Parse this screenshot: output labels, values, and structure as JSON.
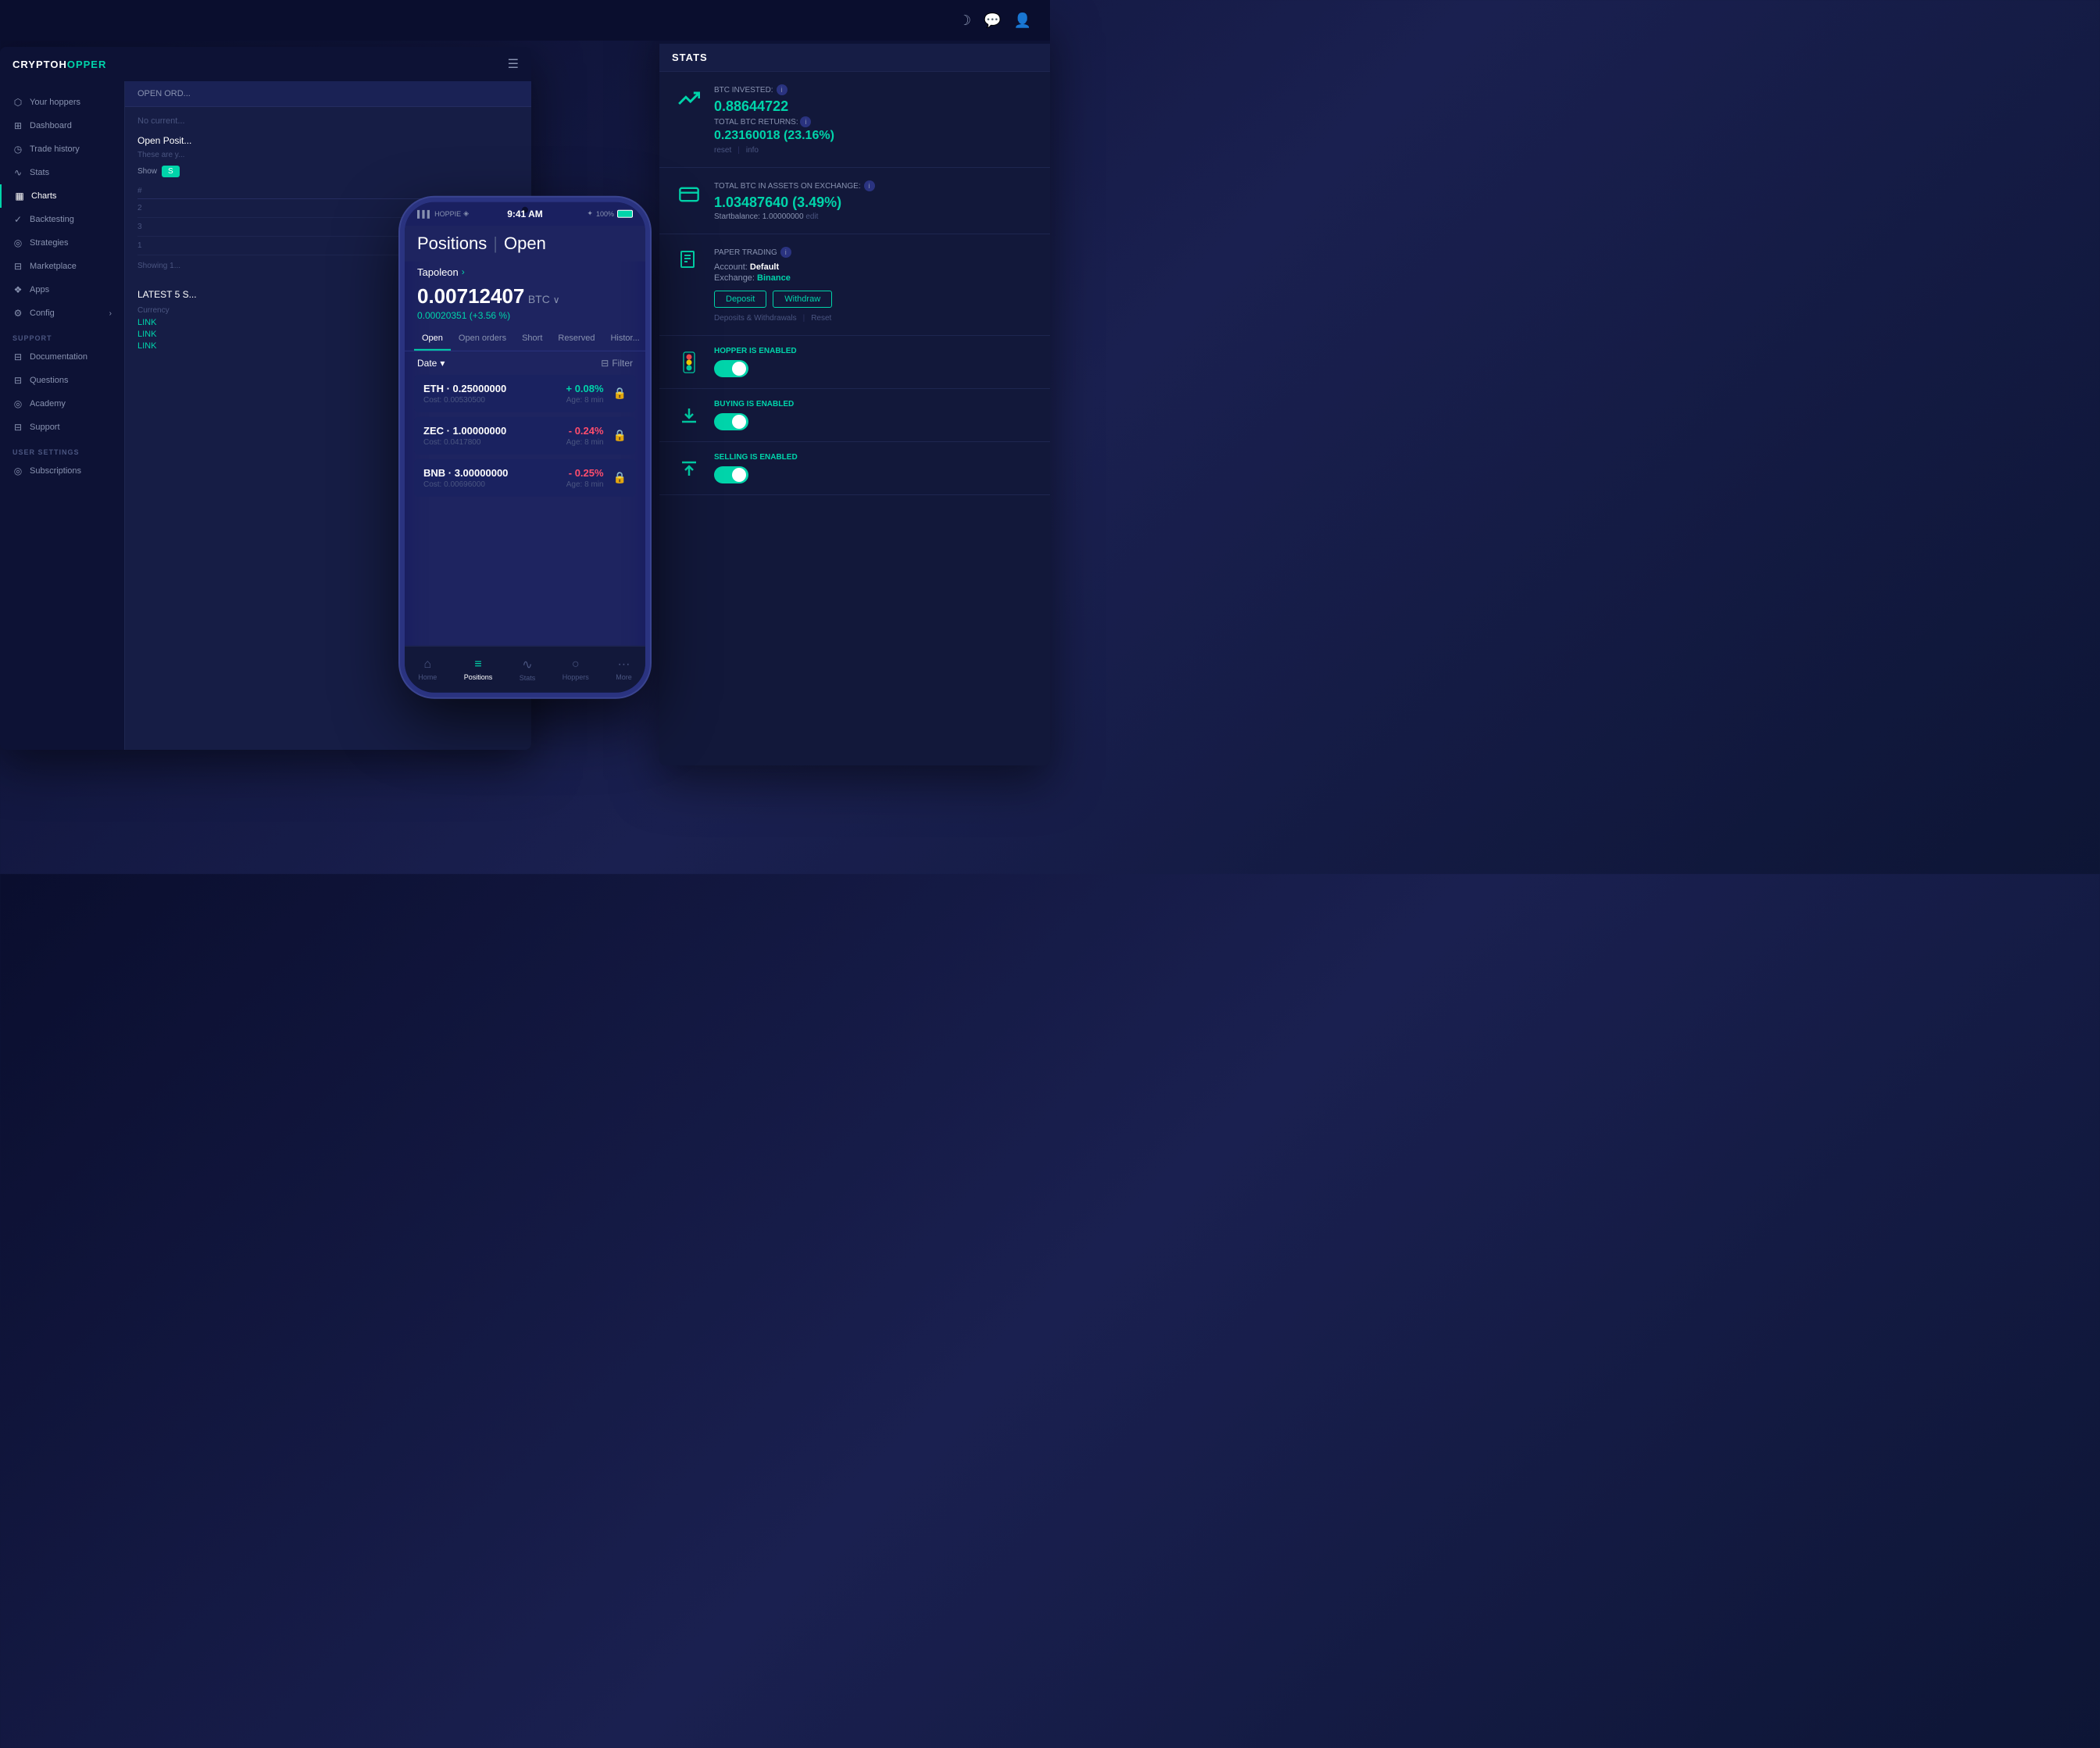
{
  "global": {
    "topbar_icons": [
      "moon",
      "chat",
      "user"
    ]
  },
  "desktop": {
    "logo": "CRYPTOH",
    "logo_accent": "OPPER",
    "sidebar": {
      "items": [
        {
          "id": "your-hoppers",
          "icon": "⬡",
          "label": "Your hoppers"
        },
        {
          "id": "dashboard",
          "icon": "⊞",
          "label": "Dashboard"
        },
        {
          "id": "trade-history",
          "icon": "◷",
          "label": "Trade history"
        },
        {
          "id": "stats",
          "icon": "∿",
          "label": "Stats"
        },
        {
          "id": "charts",
          "icon": "▦",
          "label": "Charts",
          "active": true
        },
        {
          "id": "backtesting",
          "icon": "✓",
          "label": "Backtesting"
        },
        {
          "id": "strategies",
          "icon": "◎",
          "label": "Strategies"
        },
        {
          "id": "marketplace",
          "icon": "⊟",
          "label": "Marketplace"
        },
        {
          "id": "apps",
          "icon": "❖",
          "label": "Apps"
        },
        {
          "id": "config",
          "icon": "⚙",
          "label": "Config",
          "has_arrow": true
        }
      ],
      "support_section": "SUPPORT",
      "support_items": [
        {
          "id": "documentation",
          "icon": "⊟",
          "label": "Documentation"
        },
        {
          "id": "questions",
          "icon": "⊟",
          "label": "Questions"
        },
        {
          "id": "academy",
          "icon": "◎",
          "label": "Academy"
        },
        {
          "id": "support",
          "icon": "⊟",
          "label": "Support"
        }
      ],
      "user_section": "USER SETTINGS",
      "user_items": [
        {
          "id": "subscriptions",
          "icon": "◎",
          "label": "Subscriptions"
        }
      ]
    },
    "main": {
      "open_orders_title": "OPEN ORD...",
      "no_current": "No current...",
      "open_positions_title": "Open Posit...",
      "these_are": "These are y...",
      "show_label": "Show",
      "table": {
        "headers": [
          "#",
          ""
        ],
        "rows": [
          {
            "num": "2"
          },
          {
            "num": "3"
          },
          {
            "num": "1"
          }
        ]
      },
      "showing_text": "Showing 1...",
      "latest_title": "LATEST 5 S...",
      "currency_label": "Currency",
      "links": [
        "LINK",
        "LINK",
        "LINK"
      ]
    }
  },
  "stats_panel": {
    "title": "STATS",
    "topbar_controls": [
      "–",
      "×"
    ],
    "cards": [
      {
        "id": "btc-invested",
        "icon": "📈",
        "label": "BTC INVESTED:",
        "value": "0.88644722",
        "sublabel": "TOTAL BTC RETURNS:",
        "subvalue": "0.23160018 (23.16%)",
        "links": [
          "reset",
          "info"
        ]
      },
      {
        "id": "btc-assets",
        "icon": "💳",
        "label": "TOTAL BTC IN ASSETS ON EXCHANGE:",
        "value": "1.03487640 (3.49%)",
        "startbalance": "Startbalance: 1.00000000",
        "edit_label": "edit"
      },
      {
        "id": "paper-trading",
        "icon": "📄",
        "label": "PAPER TRADING",
        "account_label": "Account:",
        "account_value": "Default",
        "exchange_label": "Exchange:",
        "exchange_value": "Binance",
        "buttons": [
          "Deposit",
          "Withdraw"
        ],
        "links": [
          "Deposits & Withdrawals",
          "Reset"
        ]
      },
      {
        "id": "hopper-enabled",
        "icon": "🚦",
        "label": "HOPPER IS",
        "status": "ENABLED",
        "toggle": true
      },
      {
        "id": "buying-enabled",
        "icon": "⬇",
        "label": "BUYING IS",
        "status": "ENABLED",
        "toggle": true
      },
      {
        "id": "selling-enabled",
        "icon": "⬆",
        "label": "SELLING IS",
        "status": "ENABLED",
        "toggle": true
      }
    ]
  },
  "mobile": {
    "carrier": "HOPPIE",
    "time": "9:41 AM",
    "battery": "100%",
    "bluetooth_icon": "✦",
    "header_title": "Positions",
    "header_divider": "|",
    "header_page": "Open",
    "hopper_name": "Tapoleon",
    "amount": "0.00712407",
    "currency": "BTC",
    "amount_change": "0.00020351 (+3.56 %)",
    "tabs": [
      {
        "id": "open",
        "label": "Open",
        "active": true
      },
      {
        "id": "open-orders",
        "label": "Open orders"
      },
      {
        "id": "short",
        "label": "Short"
      },
      {
        "id": "reserved",
        "label": "Reserved"
      },
      {
        "id": "history",
        "label": "Histor..."
      }
    ],
    "filter_date": "Date",
    "filter_label": "Filter",
    "positions": [
      {
        "coin": "ETH · 0.25000000",
        "cost": "Cost: 0.00530500",
        "pct": "+ 0.08%",
        "pct_type": "positive",
        "age": "Age: 8 min"
      },
      {
        "coin": "ZEC · 1.00000000",
        "cost": "Cost: 0.0417800",
        "pct": "- 0.24%",
        "pct_type": "negative",
        "age": "Age: 8 min"
      },
      {
        "coin": "BNB · 3.00000000",
        "cost": "Cost: 0.00696000",
        "pct": "- 0.25%",
        "pct_type": "negative",
        "age": "Age: 8 min"
      }
    ],
    "nav_items": [
      {
        "id": "home",
        "icon": "⌂",
        "label": "Home"
      },
      {
        "id": "positions",
        "icon": "≡",
        "label": "Positions",
        "active": true
      },
      {
        "id": "stats",
        "icon": "∿",
        "label": "Stats"
      },
      {
        "id": "hoppers",
        "icon": "○",
        "label": "Hoppers"
      },
      {
        "id": "more",
        "icon": "···",
        "label": "More"
      }
    ]
  }
}
